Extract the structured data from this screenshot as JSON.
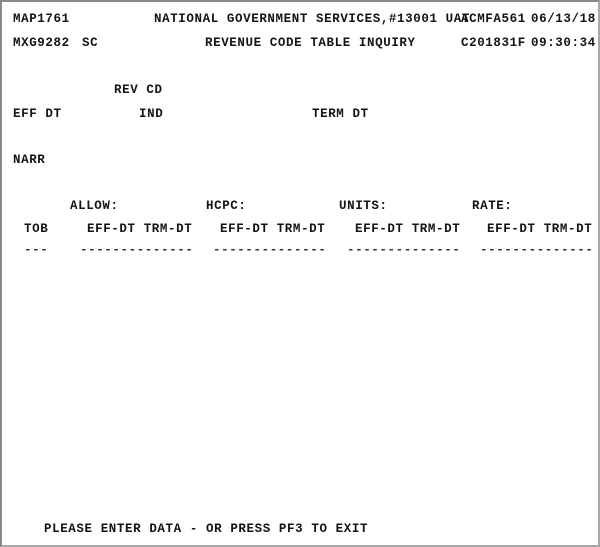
{
  "screen": {
    "type": "ibm-3270-terminal",
    "system": "CICS",
    "background_color": "#ffffff",
    "text_color": "#141414",
    "border_color": "#8a8a8a",
    "columns": 80,
    "rows": 24
  },
  "header": {
    "map_id": "MAP1761",
    "organization": "NATIONAL GOVERNMENT SERVICES,#13001 UAT",
    "user_id": "ACMFA561",
    "date": "06/13/18",
    "transaction_id": "MXG9282",
    "sc_label": "SC",
    "sc_value": "",
    "title": "REVENUE CODE TABLE INQUIRY",
    "terminal_id": "C201831F",
    "time": "09:30:34"
  },
  "keyfields": {
    "rev_cd_label": "REV CD",
    "rev_cd_value": "",
    "eff_dt_label": "EFF DT",
    "eff_dt_value": "",
    "ind_label": "IND",
    "ind_value": "",
    "term_dt_label": "TERM DT",
    "term_dt_value": "",
    "narr_label": "NARR",
    "narr_value": ""
  },
  "table": {
    "group_headers": [
      "ALLOW:",
      "HCPC:",
      "UNITS:",
      "RATE:"
    ],
    "tob_header": "TOB",
    "date_headers": [
      "EFF-DT TRM-DT",
      "EFF-DT TRM-DT",
      "EFF-DT TRM-DT",
      "EFF-DT TRM-DT"
    ],
    "tob_rule": "---",
    "date_rule": "--------------",
    "rows": []
  },
  "footer": {
    "message": "PLEASE ENTER DATA - OR PRESS PF3 TO EXIT"
  }
}
